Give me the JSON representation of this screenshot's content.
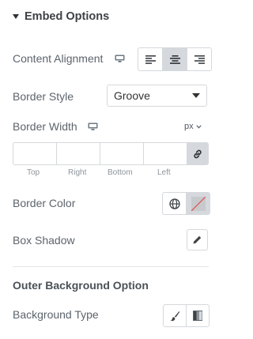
{
  "section": {
    "title": "Embed Options",
    "caret_icon": "caret-down-icon"
  },
  "content_alignment": {
    "label": "Content Alignment",
    "responsive_icon": "desktop-icon",
    "options": [
      {
        "name": "align-left",
        "icon": "align-left-icon"
      },
      {
        "name": "align-center",
        "icon": "align-center-icon"
      },
      {
        "name": "align-right",
        "icon": "align-right-icon"
      }
    ],
    "selected": "align-center"
  },
  "border_style": {
    "label": "Border Style",
    "value": "Groove"
  },
  "border_width": {
    "label": "Border Width",
    "responsive_icon": "desktop-icon",
    "unit": "px",
    "fields": {
      "top": "Top",
      "right": "Right",
      "bottom": "Bottom",
      "left": "Left"
    },
    "values": {
      "top": "",
      "right": "",
      "bottom": "",
      "left": ""
    },
    "link_icon": "link-icon"
  },
  "border_color": {
    "label": "Border Color",
    "global_icon": "globe-icon",
    "swatch": "none"
  },
  "box_shadow": {
    "label": "Box Shadow",
    "edit_icon": "pencil-icon"
  },
  "outer_background": {
    "title": "Outer Background Option",
    "type_label": "Background Type",
    "options": [
      {
        "name": "classic",
        "icon": "brush-icon"
      },
      {
        "name": "gradient",
        "icon": "gradient-icon"
      }
    ]
  },
  "colors": {
    "border": "#d5d8dc",
    "active": "#d5d8dc",
    "text": "#5c646c",
    "no_color_line": "#e05555"
  }
}
